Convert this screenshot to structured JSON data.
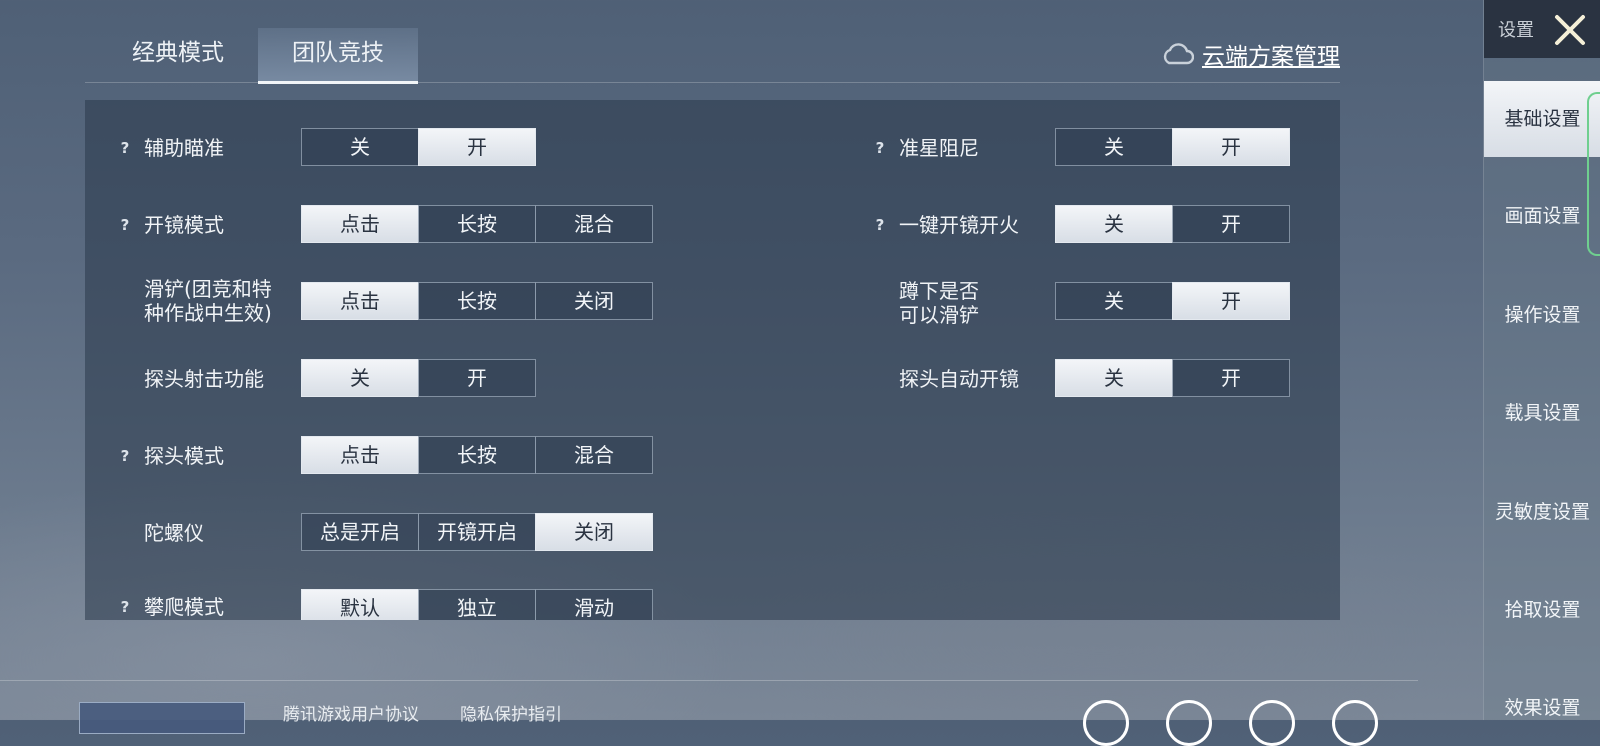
{
  "tabs": [
    {
      "label": "经典模式"
    },
    {
      "label": "团队竞技"
    }
  ],
  "cloud": {
    "label": "云端方案管理"
  },
  "settings_left": [
    {
      "label": "辅助瞄准",
      "help": "?",
      "options": [
        "关",
        "开"
      ],
      "selected": 1
    },
    {
      "label": "开镜模式",
      "help": "?",
      "options": [
        "点击",
        "长按",
        "混合"
      ],
      "selected": 0
    },
    {
      "label_lines": [
        "滑铲(团竞和特",
        "种作战中生效)"
      ],
      "options": [
        "点击",
        "长按",
        "关闭"
      ],
      "selected": 0
    },
    {
      "label": "探头射击功能",
      "options": [
        "关",
        "开"
      ],
      "selected": 0
    },
    {
      "label": "探头模式",
      "help": "?",
      "options": [
        "点击",
        "长按",
        "混合"
      ],
      "selected": 0
    },
    {
      "label": "陀螺仪",
      "options": [
        "总是开启",
        "开镜开启",
        "关闭"
      ],
      "selected": 2
    },
    {
      "label": "攀爬模式",
      "help": "?",
      "options": [
        "默认",
        "独立",
        "滑动"
      ],
      "selected": 0
    }
  ],
  "settings_right": [
    {
      "label": "准星阻尼",
      "help": "?",
      "options": [
        "关",
        "开"
      ],
      "selected": 1
    },
    {
      "label": "一键开镜开火",
      "help": "?",
      "options": [
        "关",
        "开"
      ],
      "selected": 0
    },
    {
      "label_lines": [
        "蹲下是否",
        "可以滑铲"
      ],
      "options": [
        "关",
        "开"
      ],
      "selected": 1
    },
    {
      "label": "探头自动开镜",
      "options": [
        "关",
        "开"
      ],
      "selected": 0
    }
  ],
  "sidebar": {
    "title": "设置",
    "items": [
      {
        "label": "基础设置"
      },
      {
        "label": "画面设置"
      },
      {
        "label": "操作设置"
      },
      {
        "label": "载具设置"
      },
      {
        "label": "灵敏度设置"
      },
      {
        "label": "拾取设置"
      },
      {
        "label": "效果设置"
      }
    ],
    "active_index": 0
  },
  "footer": {
    "links": [
      "腾讯游戏用户协议",
      "隐私保护指引"
    ]
  },
  "colors": {
    "selected_bg": "#eef1f5",
    "panel_bg": "#2a384a",
    "accent_green": "#6fcf8f"
  },
  "icons": [
    "cloud-icon",
    "close-icon",
    "help-icon"
  ]
}
